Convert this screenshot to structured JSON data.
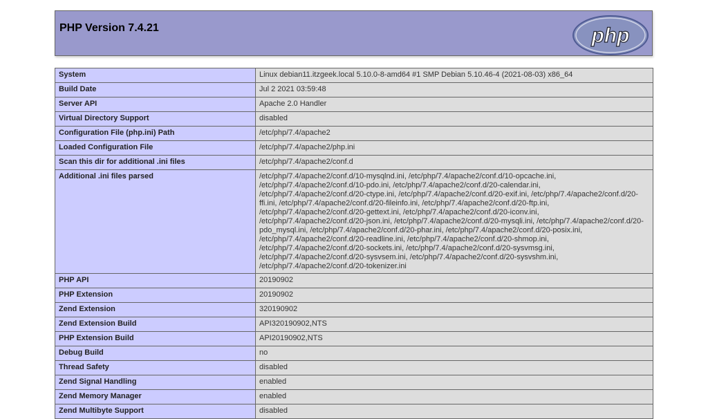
{
  "header": {
    "title": "PHP Version 7.4.21",
    "logo_text": "php"
  },
  "rows": [
    {
      "key": "System",
      "value": "Linux debian11.itzgeek.local 5.10.0-8-amd64 #1 SMP Debian 5.10.46-4 (2021-08-03) x86_64"
    },
    {
      "key": "Build Date",
      "value": "Jul 2 2021 03:59:48"
    },
    {
      "key": "Server API",
      "value": "Apache 2.0 Handler"
    },
    {
      "key": "Virtual Directory Support",
      "value": "disabled"
    },
    {
      "key": "Configuration File (php.ini) Path",
      "value": "/etc/php/7.4/apache2"
    },
    {
      "key": "Loaded Configuration File",
      "value": "/etc/php/7.4/apache2/php.ini"
    },
    {
      "key": "Scan this dir for additional .ini files",
      "value": "/etc/php/7.4/apache2/conf.d"
    },
    {
      "key": "Additional .ini files parsed",
      "value": "/etc/php/7.4/apache2/conf.d/10-mysqlnd.ini, /etc/php/7.4/apache2/conf.d/10-opcache.ini,\n/etc/php/7.4/apache2/conf.d/10-pdo.ini, /etc/php/7.4/apache2/conf.d/20-calendar.ini,\n/etc/php/7.4/apache2/conf.d/20-ctype.ini, /etc/php/7.4/apache2/conf.d/20-exif.ini, /etc/php/7.4/apache2/conf.d/20-\nffi.ini, /etc/php/7.4/apache2/conf.d/20-fileinfo.ini, /etc/php/7.4/apache2/conf.d/20-ftp.ini,\n/etc/php/7.4/apache2/conf.d/20-gettext.ini, /etc/php/7.4/apache2/conf.d/20-iconv.ini,\n/etc/php/7.4/apache2/conf.d/20-json.ini, /etc/php/7.4/apache2/conf.d/20-mysqli.ini, /etc/php/7.4/apache2/conf.d/20-\npdo_mysql.ini, /etc/php/7.4/apache2/conf.d/20-phar.ini, /etc/php/7.4/apache2/conf.d/20-posix.ini,\n/etc/php/7.4/apache2/conf.d/20-readline.ini, /etc/php/7.4/apache2/conf.d/20-shmop.ini,\n/etc/php/7.4/apache2/conf.d/20-sockets.ini, /etc/php/7.4/apache2/conf.d/20-sysvmsg.ini,\n/etc/php/7.4/apache2/conf.d/20-sysvsem.ini, /etc/php/7.4/apache2/conf.d/20-sysvshm.ini,\n/etc/php/7.4/apache2/conf.d/20-tokenizer.ini"
    },
    {
      "key": "PHP API",
      "value": "20190902"
    },
    {
      "key": "PHP Extension",
      "value": "20190902"
    },
    {
      "key": "Zend Extension",
      "value": "320190902"
    },
    {
      "key": "Zend Extension Build",
      "value": "API320190902,NTS"
    },
    {
      "key": "PHP Extension Build",
      "value": "API20190902,NTS"
    },
    {
      "key": "Debug Build",
      "value": "no"
    },
    {
      "key": "Thread Safety",
      "value": "disabled"
    },
    {
      "key": "Zend Signal Handling",
      "value": "enabled"
    },
    {
      "key": "Zend Memory Manager",
      "value": "enabled"
    },
    {
      "key": "Zend Multibyte Support",
      "value": "disabled"
    }
  ],
  "colors": {
    "header_bg": "#9999cc",
    "key_bg": "#ccccff",
    "value_bg": "#dddddd",
    "border": "#666666"
  }
}
